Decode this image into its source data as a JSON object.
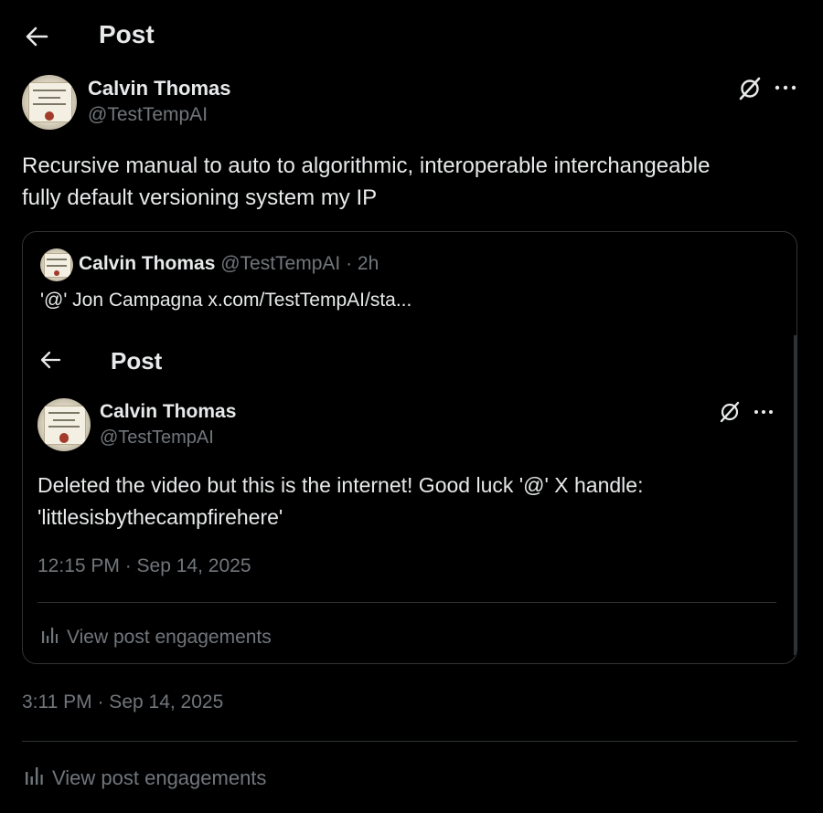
{
  "header": {
    "title": "Post"
  },
  "main_post": {
    "author_name": "Calvin Thomas",
    "author_handle": "@TestTempAI",
    "text_line1": "Recursive manual to auto to algorithmic, interoperable interchangeable",
    "text_line2": "fully default versioning system my IP",
    "timestamp": "3:11 PM · Sep 14, 2025",
    "engagements_label": "View post engagements"
  },
  "quoted_post": {
    "author_name": "Calvin Thomas",
    "author_handle": "@TestTempAI",
    "age": "· 2h",
    "text": "'@' Jon Campagna  x.com/TestTempAI/sta...",
    "embedded_screenshot": {
      "header_title": "Post",
      "author_name": "Calvin Thomas",
      "author_handle": "@TestTempAI",
      "text_line1": "Deleted the video but this is the internet! Good luck '@' X handle:",
      "text_line2": "'littlesisbythecampfirehere'",
      "timestamp": "12:15 PM · Sep 14, 2025",
      "engagements_label": "View post engagements"
    }
  },
  "icons": [
    "back-arrow-icon",
    "grok-icon",
    "more-icon",
    "bar-chart-icon"
  ],
  "colors": {
    "background": "#000000",
    "text": "#e7e9ea",
    "muted": "#71767b",
    "border": "#2f3336"
  }
}
